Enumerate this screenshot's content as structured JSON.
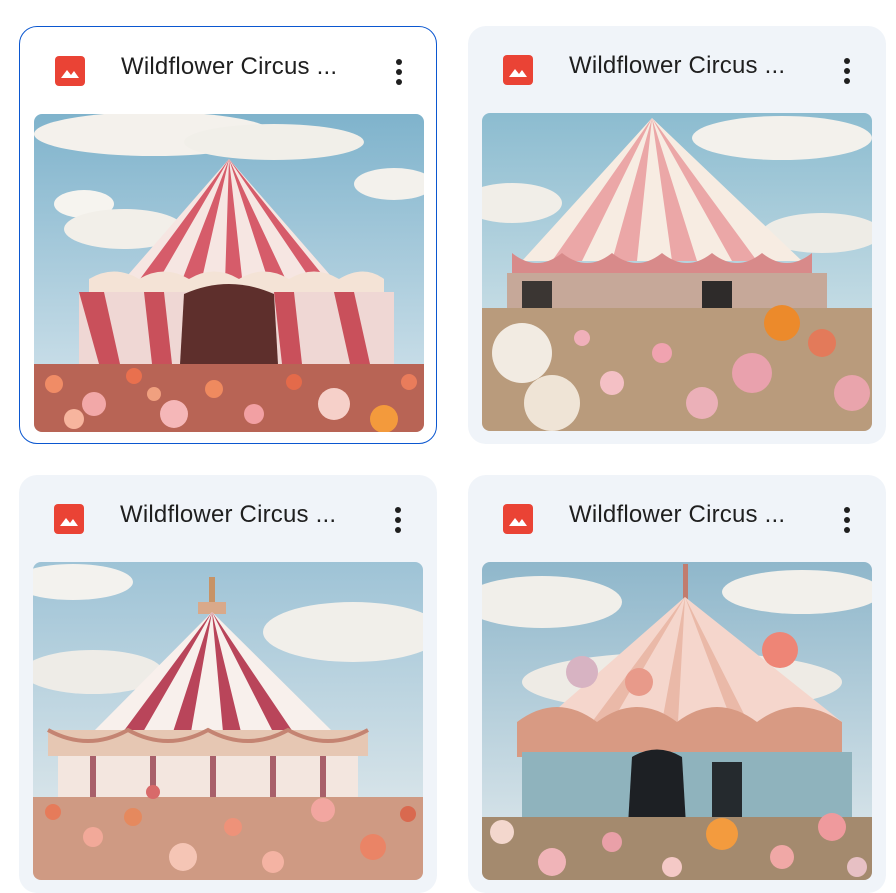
{
  "files": [
    {
      "title": "Wildflower Circus ...",
      "type_icon": "image-file-icon",
      "more_icon": "more-vertical-icon",
      "selected": true
    },
    {
      "title": "Wildflower Circus ...",
      "type_icon": "image-file-icon",
      "more_icon": "more-vertical-icon",
      "selected": false
    },
    {
      "title": "Wildflower Circus ...",
      "type_icon": "image-file-icon",
      "more_icon": "more-vertical-icon",
      "selected": false
    },
    {
      "title": "Wildflower Circus ...",
      "type_icon": "image-file-icon",
      "more_icon": "more-vertical-icon",
      "selected": false
    }
  ],
  "colors": {
    "card_bg": "#f0f4f9",
    "selected_border": "#0b57d0",
    "image_icon": "#ea4335",
    "title_text": "#1f1f1f"
  }
}
